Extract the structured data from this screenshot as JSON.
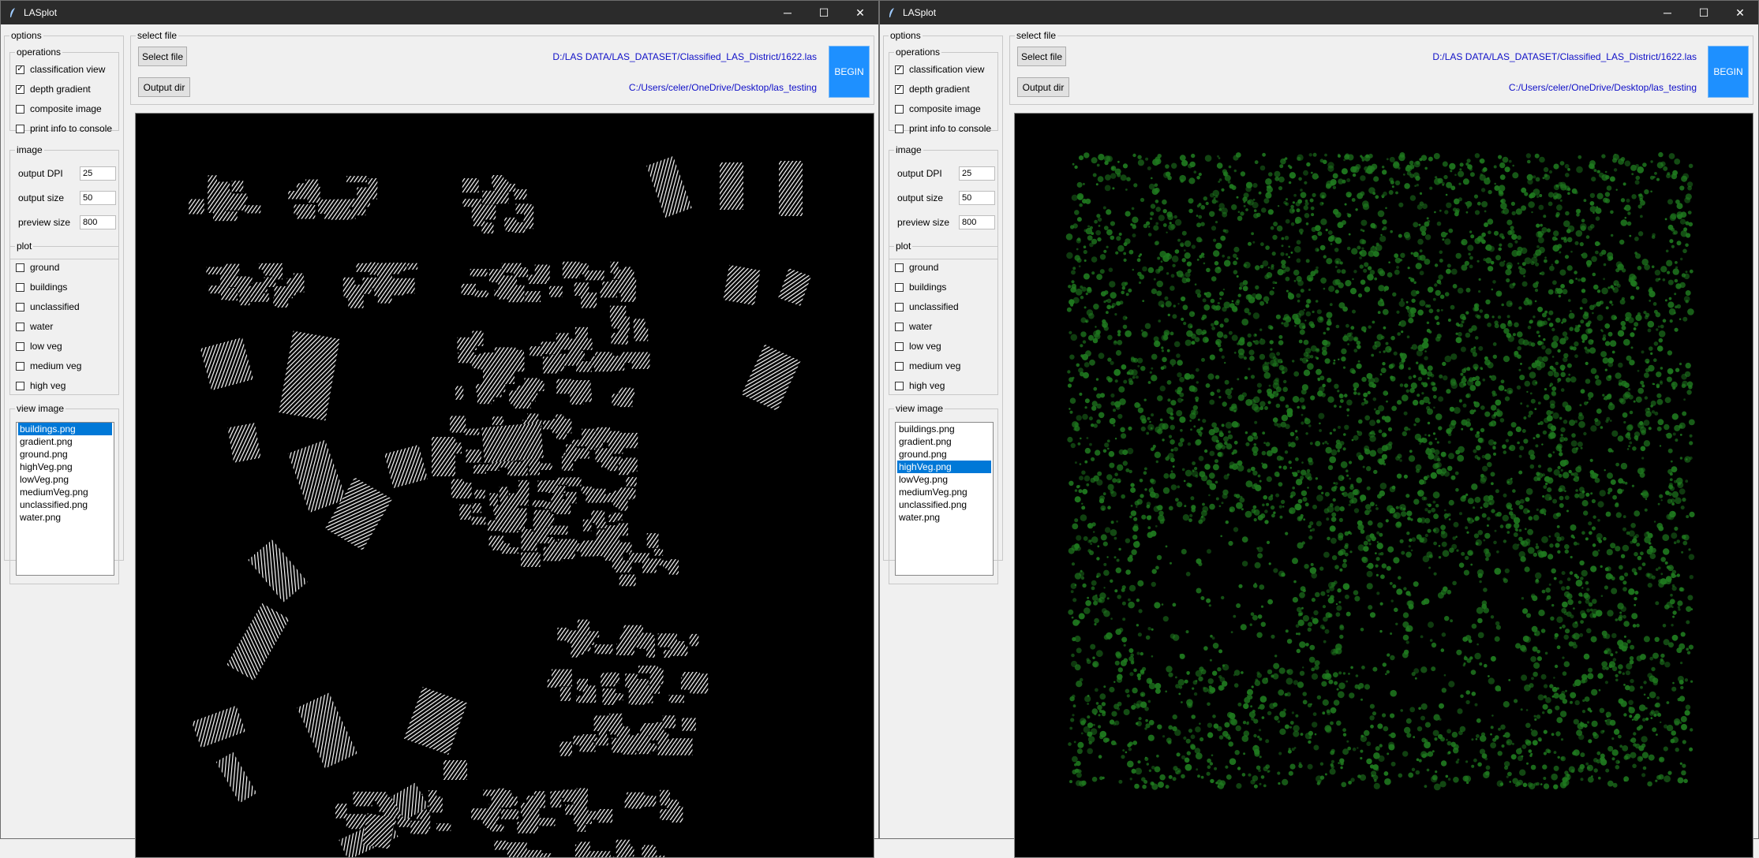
{
  "windows": [
    {
      "title": "LASplot",
      "title_controls": {
        "minimize": "─",
        "maximize": "☐",
        "close": "✕"
      },
      "options": {
        "legend": "options",
        "operations": {
          "legend": "operations",
          "items": [
            {
              "label": "classification view",
              "checked": true
            },
            {
              "label": "depth gradient",
              "checked": true
            },
            {
              "label": "composite image",
              "checked": false
            },
            {
              "label": "print info to console",
              "checked": false
            }
          ]
        },
        "image": {
          "legend": "image",
          "fields": [
            {
              "label": "output DPI",
              "value": "25"
            },
            {
              "label": "output size",
              "value": "50"
            },
            {
              "label": "preview size",
              "value": "800"
            }
          ]
        },
        "plot": {
          "legend": "plot",
          "items": [
            {
              "label": "ground",
              "checked": false
            },
            {
              "label": "buildings",
              "checked": false
            },
            {
              "label": "unclassified",
              "checked": false
            },
            {
              "label": "water",
              "checked": false
            },
            {
              "label": "low veg",
              "checked": false
            },
            {
              "label": "medium veg",
              "checked": false
            },
            {
              "label": "high veg",
              "checked": false
            }
          ]
        },
        "view_image": {
          "legend": "view image",
          "files": [
            "buildings.png",
            "gradient.png",
            "ground.png",
            "highVeg.png",
            "lowVeg.png",
            "mediumVeg.png",
            "unclassified.png",
            "water.png"
          ],
          "selected_index": 0
        }
      },
      "select_file": {
        "legend": "select file",
        "select_button": "Select file",
        "output_button": "Output dir",
        "input_path": "D:/LAS DATA/LAS_DATASET/Classified_LAS_District/1622.las",
        "output_path": "C:/Users/celer/OneDrive/Desktop/las_testing",
        "begin_button": "BEGIN"
      },
      "preview": {
        "image": "buildings.png",
        "point_color": "#ffffff"
      }
    },
    {
      "title": "LASplot",
      "title_controls": {
        "minimize": "─",
        "maximize": "☐",
        "close": "✕"
      },
      "options": {
        "legend": "options",
        "operations": {
          "legend": "operations",
          "items": [
            {
              "label": "classification view",
              "checked": true
            },
            {
              "label": "depth gradient",
              "checked": true
            },
            {
              "label": "composite image",
              "checked": false
            },
            {
              "label": "print info to console",
              "checked": false
            }
          ]
        },
        "image": {
          "legend": "image",
          "fields": [
            {
              "label": "output DPI",
              "value": "25"
            },
            {
              "label": "output size",
              "value": "50"
            },
            {
              "label": "preview size",
              "value": "800"
            }
          ]
        },
        "plot": {
          "legend": "plot",
          "items": [
            {
              "label": "ground",
              "checked": false
            },
            {
              "label": "buildings",
              "checked": false
            },
            {
              "label": "unclassified",
              "checked": false
            },
            {
              "label": "water",
              "checked": false
            },
            {
              "label": "low veg",
              "checked": false
            },
            {
              "label": "medium veg",
              "checked": false
            },
            {
              "label": "high veg",
              "checked": false
            }
          ]
        },
        "view_image": {
          "legend": "view image",
          "files": [
            "buildings.png",
            "gradient.png",
            "ground.png",
            "highVeg.png",
            "lowVeg.png",
            "mediumVeg.png",
            "unclassified.png",
            "water.png"
          ],
          "selected_index": 3
        }
      },
      "select_file": {
        "legend": "select file",
        "select_button": "Select file",
        "output_button": "Output dir",
        "input_path": "D:/LAS DATA/LAS_DATASET/Classified_LAS_District/1622.las",
        "output_path": "C:/Users/celer/OneDrive/Desktop/las_testing",
        "begin_button": "BEGIN"
      },
      "preview": {
        "image": "highVeg.png",
        "point_color": "#1f7a1f"
      }
    }
  ],
  "colors": {
    "accent": "#0078d7",
    "begin": "#1e90ff",
    "path_text": "#1010c8",
    "titlebar": "#2b2b2b"
  }
}
